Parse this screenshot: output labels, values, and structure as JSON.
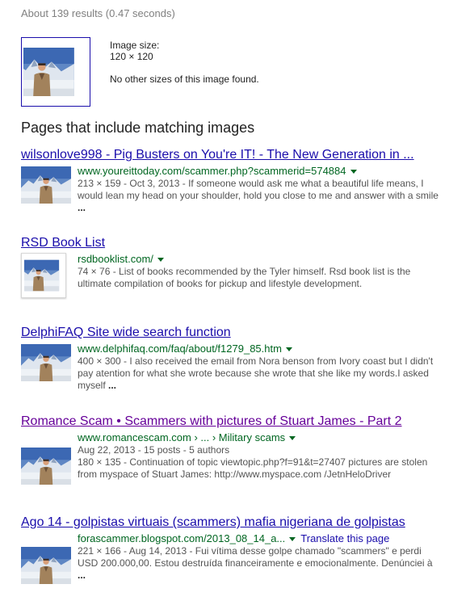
{
  "stats": "About 139 results (0.47 seconds)",
  "preview": {
    "size_label": "Image size:",
    "size_value": "120 × 120",
    "note": "No other sizes of this image found."
  },
  "heading": "Pages that include matching images",
  "results": [
    {
      "title": "wilsonlove998 - Pig Busters on You're IT! - The New Generation in ...",
      "url": "www.youreittoday.com/scammer.php?scammerid=574884",
      "snippet": "213 × 159 - Oct 3, 2013 - If someone would ask me what a beautiful life means, I would lean my head on your shoulder, hold you close to me and answer with a smile",
      "ellipsis": "..."
    },
    {
      "title": "RSD Book List",
      "url": "rsdbooklist.com/",
      "snippet": "74 × 76 - List of books recommended by the Tyler himself. Rsd book list is the ultimate compilation of books for pickup and lifestyle development."
    },
    {
      "title": "DelphiFAQ Site wide search function",
      "url": "www.delphifaq.com/faq/about/f1279_85.htm",
      "snippet": "400 × 300 - I also received the email from Nora benson from Ivory coast but I didn't pay atention for what she wrote because she wrote that she like my words.I asked myself",
      "ellipsis": "..."
    },
    {
      "title": "Romance Scam • Scammers with pictures of Stuart James - Part 2",
      "url": "www.romancescam.com › ... › Military scams",
      "meta": "Aug 22, 2013 - 15 posts - 5 authors",
      "snippet": "180 × 135 - Continuation of topic viewtopic.php?f=91&t=27407 pictures are stolen from myspace of Stuart James: http://www.myspace.com /JetnHeloDriver"
    },
    {
      "title": "Ago 14 - golpistas virtuais (scammers) mafia nigeriana de golpistas",
      "url": "forascammer.blogspot.com/2013_08_14_a...",
      "translate": "Translate this page",
      "snippet": "221 × 166 - Aug 14, 2013 - Fui vítima desse golpe chamado \"scammers\" e perdi USD 200.000,00. Estou destruída financeiramente e emocionalmente. Denúnciei à",
      "ellipsis": "..."
    }
  ]
}
